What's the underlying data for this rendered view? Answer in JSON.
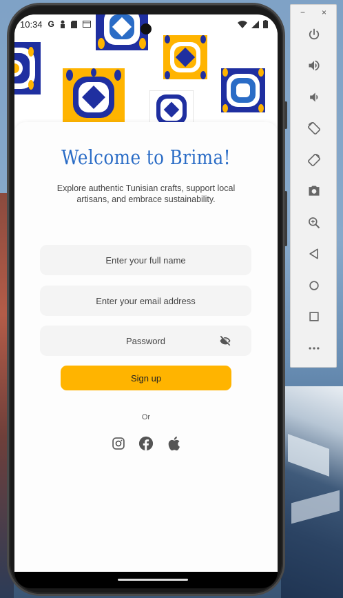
{
  "status_bar": {
    "time": "10:34",
    "icons": [
      "google-icon",
      "sim-icon",
      "sd-icon",
      "screen-icon"
    ]
  },
  "app": {
    "title": "Welcome to Brima!",
    "subtitle": "Explore authentic Tunisian crafts, support local artisans, and embrace sustainability.",
    "fields": {
      "name_placeholder": "Enter your full name",
      "email_placeholder": "Enter your email address",
      "password_placeholder": "Password"
    },
    "signup_label": "Sign up",
    "or_label": "Or",
    "socials": [
      "instagram-icon",
      "facebook-icon",
      "apple-icon"
    ]
  },
  "colors": {
    "title": "#2a6cc6",
    "accent": "#ffb400",
    "tile_blue": "#1f2fa0",
    "tile_yellow": "#ffb400",
    "field_bg": "#f4f4f4"
  },
  "emulator_panel": {
    "minimize": "−",
    "close": "×",
    "buttons": [
      "power-icon",
      "volume-up-icon",
      "volume-down-icon",
      "rotate-left-icon",
      "rotate-right-icon",
      "camera-icon",
      "zoom-icon",
      "back-icon",
      "home-icon",
      "overview-icon",
      "more-icon"
    ]
  }
}
